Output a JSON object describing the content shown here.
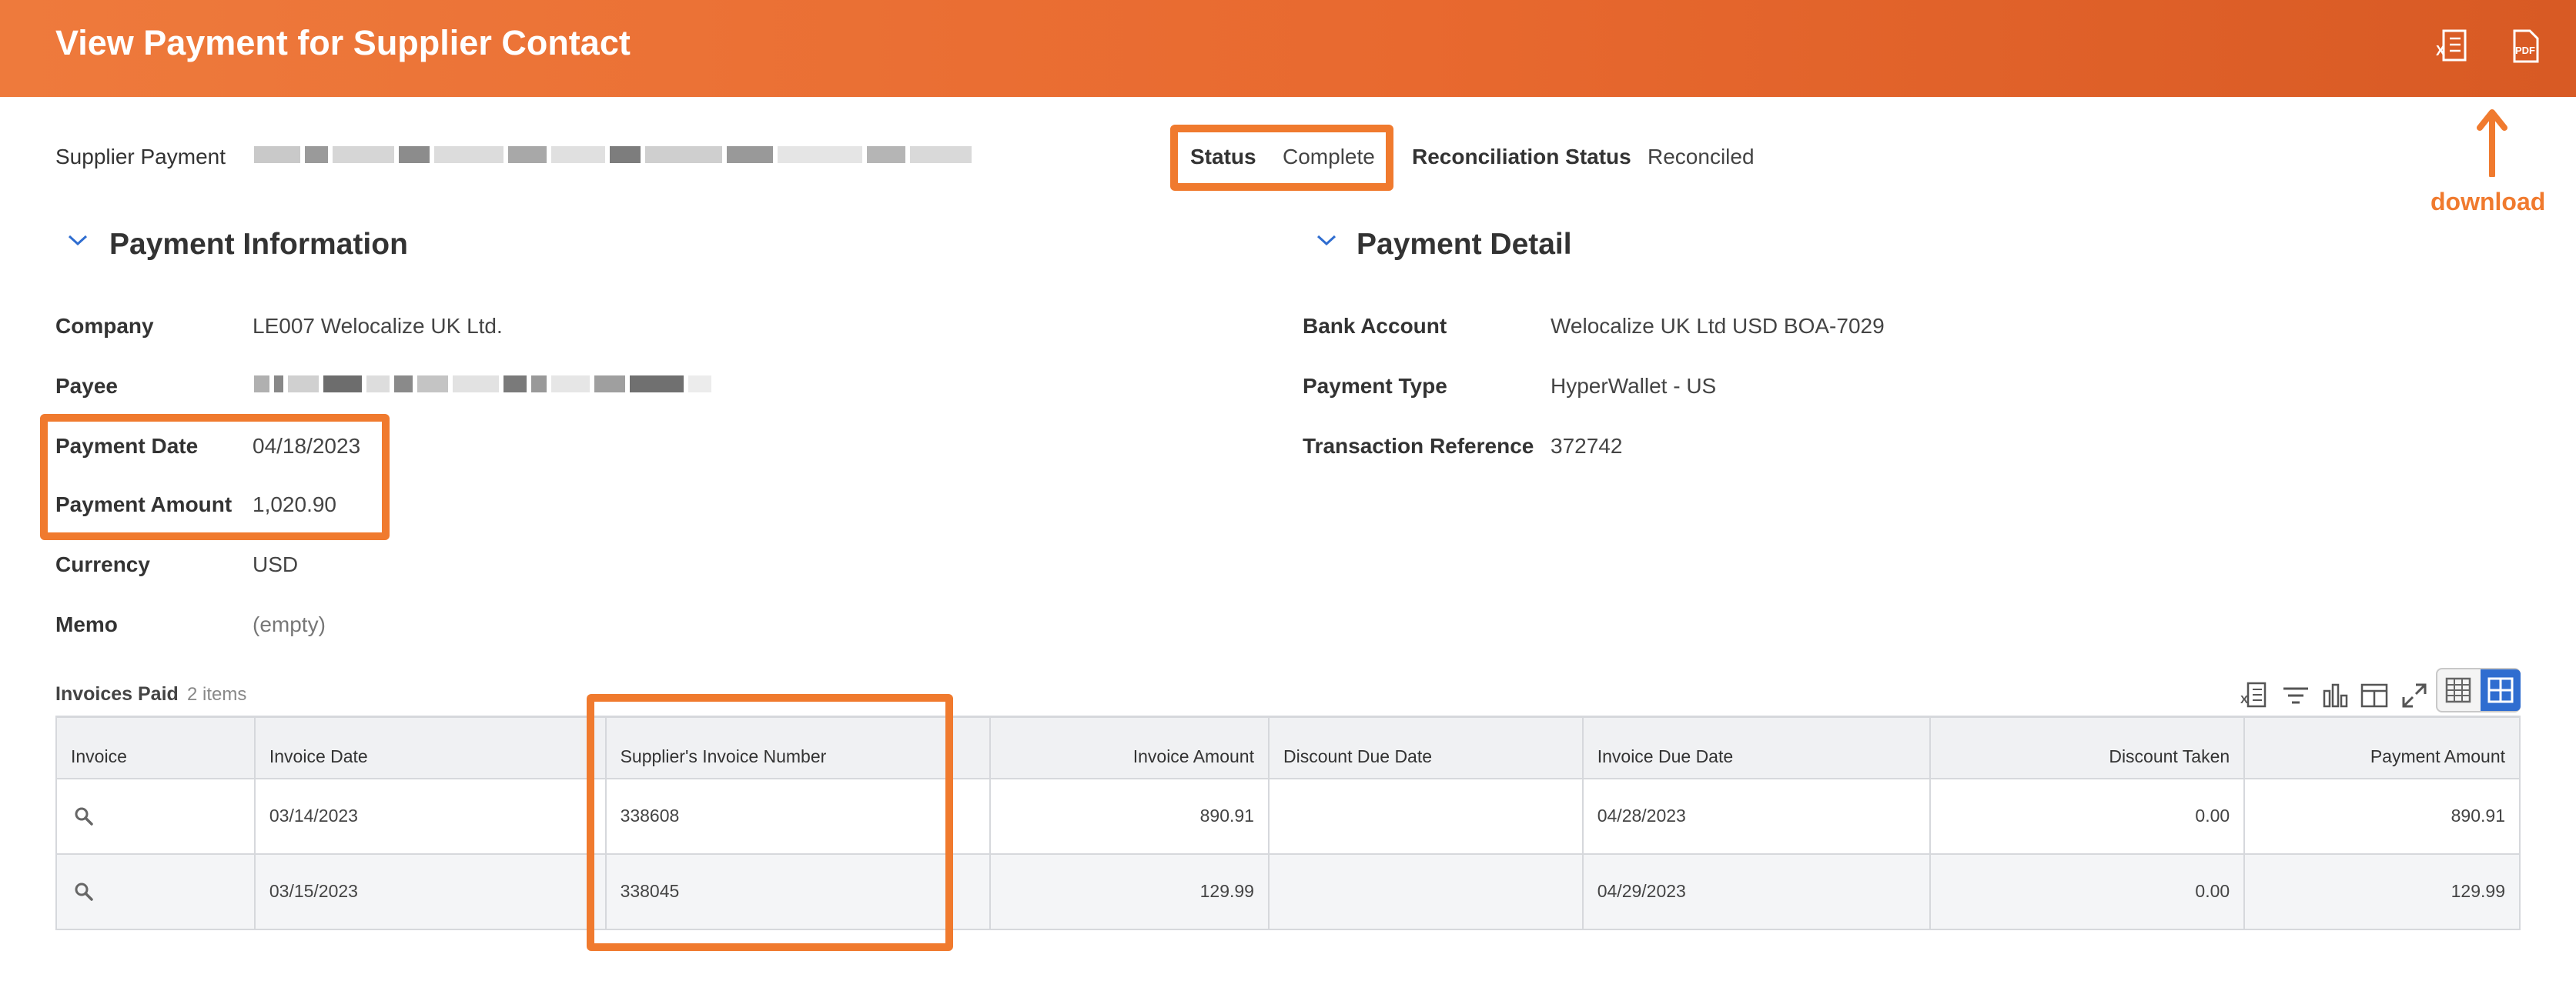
{
  "header": {
    "title": "View Payment for Supplier Contact",
    "icons": [
      "excel-export-icon",
      "pdf-export-icon"
    ]
  },
  "summary": {
    "supplier_payment_label": "Supplier Payment",
    "status_label": "Status",
    "status_value": "Complete",
    "reconciliation_label": "Reconciliation Status",
    "reconciliation_value": "Reconciled"
  },
  "annotation": {
    "download_text": "download",
    "color": "#F07A2E"
  },
  "payment_information": {
    "title": "Payment Information",
    "fields": {
      "company_label": "Company",
      "company_value": "LE007 Welocalize UK Ltd.",
      "payee_label": "Payee",
      "payment_date_label": "Payment Date",
      "payment_date_value": "04/18/2023",
      "payment_amount_label": "Payment Amount",
      "payment_amount_value": "1,020.90",
      "currency_label": "Currency",
      "currency_value": "USD",
      "memo_label": "Memo",
      "memo_value": "(empty)"
    }
  },
  "payment_detail": {
    "title": "Payment Detail",
    "fields": {
      "bank_account_label": "Bank Account",
      "bank_account_value": "Welocalize UK Ltd USD BOA-7029",
      "payment_type_label": "Payment Type",
      "payment_type_value": "HyperWallet - US",
      "transaction_reference_label": "Transaction Reference",
      "transaction_reference_value": "372742"
    }
  },
  "invoices": {
    "title": "Invoices Paid",
    "count": "2 items",
    "columns": [
      "Invoice",
      "Invoice Date",
      "Supplier's Invoice Number",
      "Invoice Amount",
      "Discount Due Date",
      "Invoice Due Date",
      "Discount Taken",
      "Payment Amount"
    ],
    "rows": [
      {
        "invoice_date": "03/14/2023",
        "supplier_invoice_number": "338608",
        "invoice_amount": "890.91",
        "discount_due_date": "",
        "invoice_due_date": "04/28/2023",
        "discount_taken": "0.00",
        "payment_amount": "890.91"
      },
      {
        "invoice_date": "03/15/2023",
        "supplier_invoice_number": "338045",
        "invoice_amount": "129.99",
        "discount_due_date": "",
        "invoice_due_date": "04/29/2023",
        "discount_taken": "0.00",
        "payment_amount": "129.99"
      }
    ]
  },
  "toolbar_icons": [
    "export-to-excel-icon",
    "filter-icon",
    "chart-icon",
    "column-layout-icon",
    "fullscreen-icon",
    "table-view-icon",
    "grid-view-icon"
  ],
  "colors": {
    "header_orange": "#E8692F",
    "highlight_orange": "#F07A2E",
    "accent_blue": "#2F6DD0"
  }
}
